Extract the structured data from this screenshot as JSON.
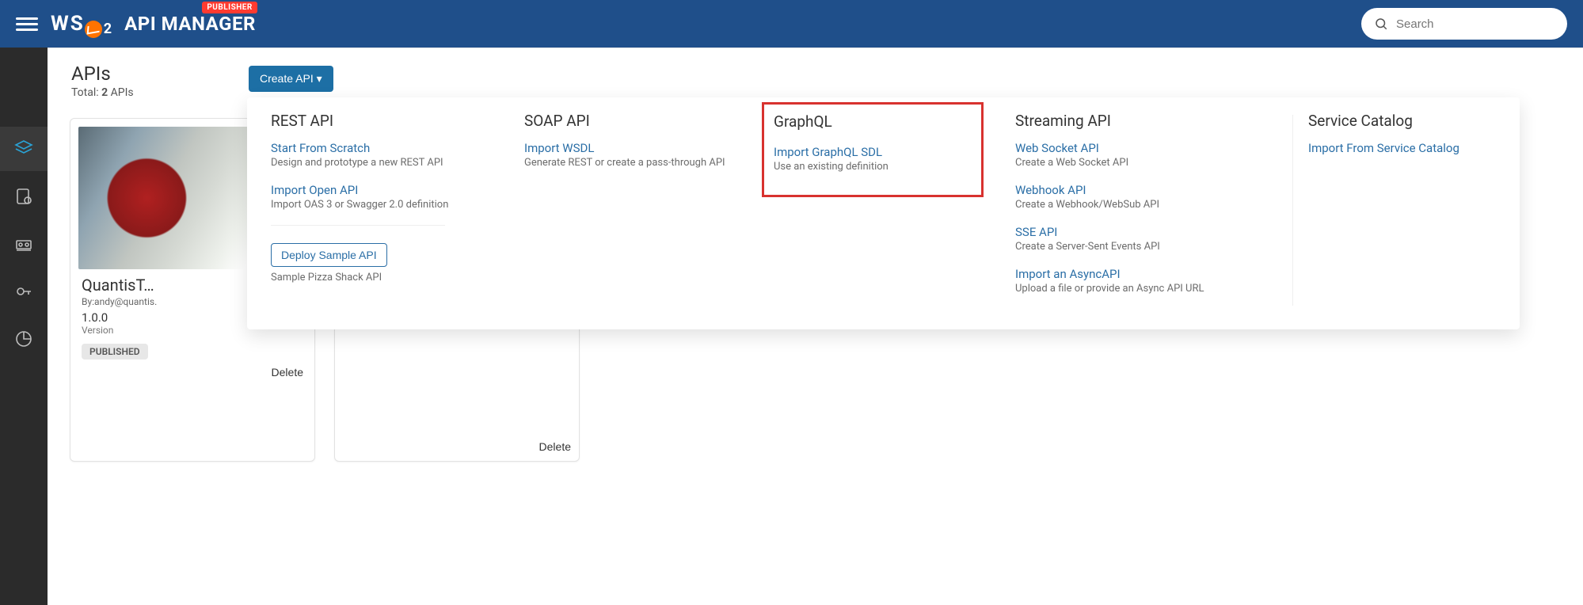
{
  "header": {
    "publisher_badge": "PUBLISHER",
    "product_name": "API MANAGER",
    "search_placeholder": "Search"
  },
  "page": {
    "title": "APIs",
    "total_label_prefix": "Total: ",
    "total_count": "2",
    "total_label_suffix": " APIs",
    "create_button": "Create API ▾"
  },
  "cards": [
    {
      "title": "QuantisT…",
      "by": "By:andy@quantis.",
      "version": "1.0.0",
      "version_label": "Version",
      "status": "PUBLISHED",
      "delete": "Delete"
    },
    {
      "delete": "Delete"
    }
  ],
  "dropdown": {
    "rest": {
      "heading": "REST API",
      "scratch_title": "Start From Scratch",
      "scratch_desc": "Design and prototype a new REST API",
      "import_title": "Import Open API",
      "import_desc": "Import OAS 3 or Swagger 2.0 definition",
      "sample_button": "Deploy Sample API",
      "sample_desc": "Sample Pizza Shack API"
    },
    "soap": {
      "heading": "SOAP API",
      "wsdl_title": "Import WSDL",
      "wsdl_desc": "Generate REST or create a pass-through API"
    },
    "graphql": {
      "heading": "GraphQL",
      "sdl_title": "Import GraphQL SDL",
      "sdl_desc": "Use an existing definition"
    },
    "stream": {
      "heading": "Streaming API",
      "ws_title": "Web Socket API",
      "ws_desc": "Create a Web Socket API",
      "webhook_title": "Webhook API",
      "webhook_desc": "Create a Webhook/WebSub API",
      "sse_title": "SSE API",
      "sse_desc": "Create a Server-Sent Events API",
      "async_title": "Import an AsyncAPI",
      "async_desc": "Upload a file or provide an Async API URL"
    },
    "catalog": {
      "heading": "Service Catalog",
      "import_title": "Import From Service Catalog"
    }
  }
}
